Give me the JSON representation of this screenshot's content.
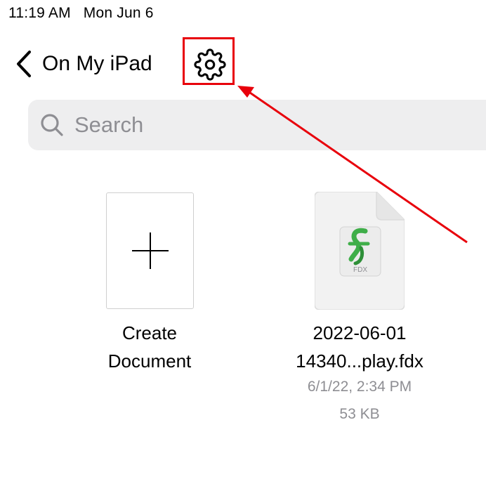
{
  "status_bar": {
    "time": "11:19 AM",
    "date": "Mon Jun 6"
  },
  "nav": {
    "back_label": "On My iPad",
    "settings_icon": "gear-icon"
  },
  "search": {
    "placeholder": "Search",
    "value": ""
  },
  "items": [
    {
      "name_line1": "Create",
      "name_line2": "Document",
      "icon": "plus-icon"
    },
    {
      "name_line1": "2022-06-01",
      "name_line2": "14340...play.fdx",
      "date": "6/1/22, 2:34 PM",
      "size": "53 KB",
      "icon": "fdx-file-icon",
      "badge_text": "FDX"
    }
  ],
  "colors": {
    "annotation": "#e8000b",
    "search_bg": "#eeeeef",
    "secondary_text": "#8e8e93",
    "fdx_green": "#3fae49"
  }
}
